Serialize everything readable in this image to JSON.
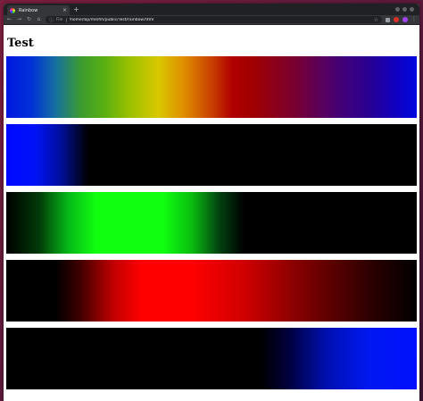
{
  "browser": {
    "tab_title": "Rainbow",
    "tab_close": "×",
    "new_tab": "+",
    "back": "←",
    "forward": "→",
    "reload": "↻",
    "home": "⌂",
    "info_icon": "ⓘ",
    "url_label": "File",
    "url": "/home/lap/me/hh/public/Test/rainbow.html",
    "star": "☆",
    "menu": "⋮"
  },
  "page": {
    "title": "Test"
  },
  "bars": [
    {
      "name": "rainbow",
      "description": "full spectrum"
    },
    {
      "name": "blue"
    },
    {
      "name": "green"
    },
    {
      "name": "red"
    },
    {
      "name": "blue-right"
    }
  ],
  "colors": {
    "blue": "#0010ff",
    "green": "#10ff10",
    "red": "#ff0000",
    "background": "#000000"
  }
}
